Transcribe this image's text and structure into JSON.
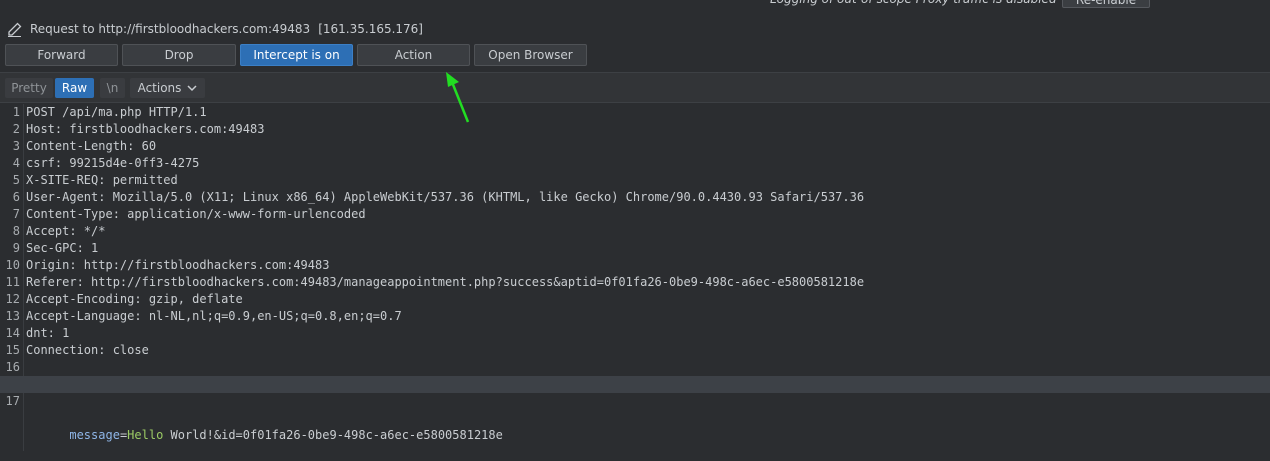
{
  "banner": {
    "note": "Logging of out-of-scope Proxy traffic is disabled",
    "reenable_label": "Re-enable"
  },
  "request": {
    "label": "Request to http://firstbloodhackers.com:49483",
    "ip": "[161.35.165.176]"
  },
  "toolbar": {
    "forward": "Forward",
    "drop": "Drop",
    "intercept": "Intercept is on",
    "action": "Action",
    "open_browser": "Open Browser"
  },
  "view_tabs": {
    "pretty": "Pretty",
    "raw": "Raw",
    "newline": "\\n",
    "actions": "Actions"
  },
  "lines": [
    {
      "n": "1",
      "k": "POST /api/ma.php HTTP/1.1",
      "v": ""
    },
    {
      "n": "2",
      "k": "Host:",
      "v": " firstbloodhackers.com:49483"
    },
    {
      "n": "3",
      "k": "Content-Length:",
      "v": " 60"
    },
    {
      "n": "4",
      "k": "csrf:",
      "v": " 99215d4e-0ff3-4275"
    },
    {
      "n": "5",
      "k": "X-SITE-REQ:",
      "v": " permitted"
    },
    {
      "n": "6",
      "k": "User-Agent:",
      "v": " Mozilla/5.0 (X11; Linux x86_64) AppleWebKit/537.36 (KHTML, like Gecko) Chrome/90.0.4430.93 Safari/537.36"
    },
    {
      "n": "7",
      "k": "Content-Type:",
      "v": " application/x-www-form-urlencoded"
    },
    {
      "n": "8",
      "k": "Accept:",
      "v": " */*"
    },
    {
      "n": "9",
      "k": "Sec-GPC:",
      "v": " 1"
    },
    {
      "n": "10",
      "k": "Origin:",
      "v": " http://firstbloodhackers.com:49483"
    },
    {
      "n": "11",
      "k": "Referer:",
      "v": " http://firstbloodhackers.com:49483/manageappointment.php?success&aptid=0f01fa26-0be9-498c-a6ec-e5800581218e"
    },
    {
      "n": "12",
      "k": "Accept-Encoding:",
      "v": " gzip, deflate"
    },
    {
      "n": "13",
      "k": "Accept-Language:",
      "v": " nl-NL,nl;q=0.9,en-US;q=0.8,en;q=0.7"
    },
    {
      "n": "14",
      "k": "dnt:",
      "v": " 1"
    },
    {
      "n": "15",
      "k": "Connection:",
      "v": " close"
    },
    {
      "n": "16",
      "k": "",
      "v": ""
    }
  ],
  "body_line": {
    "n": "17",
    "param1": "message",
    "eq1": "=",
    "val1": "Hello",
    "val1b": " World!&id=0f01fa26-0be9-498c-a6ec-e5800581218e"
  },
  "colors": {
    "accent": "#2d6fb5",
    "arrow": "#22dd22"
  }
}
